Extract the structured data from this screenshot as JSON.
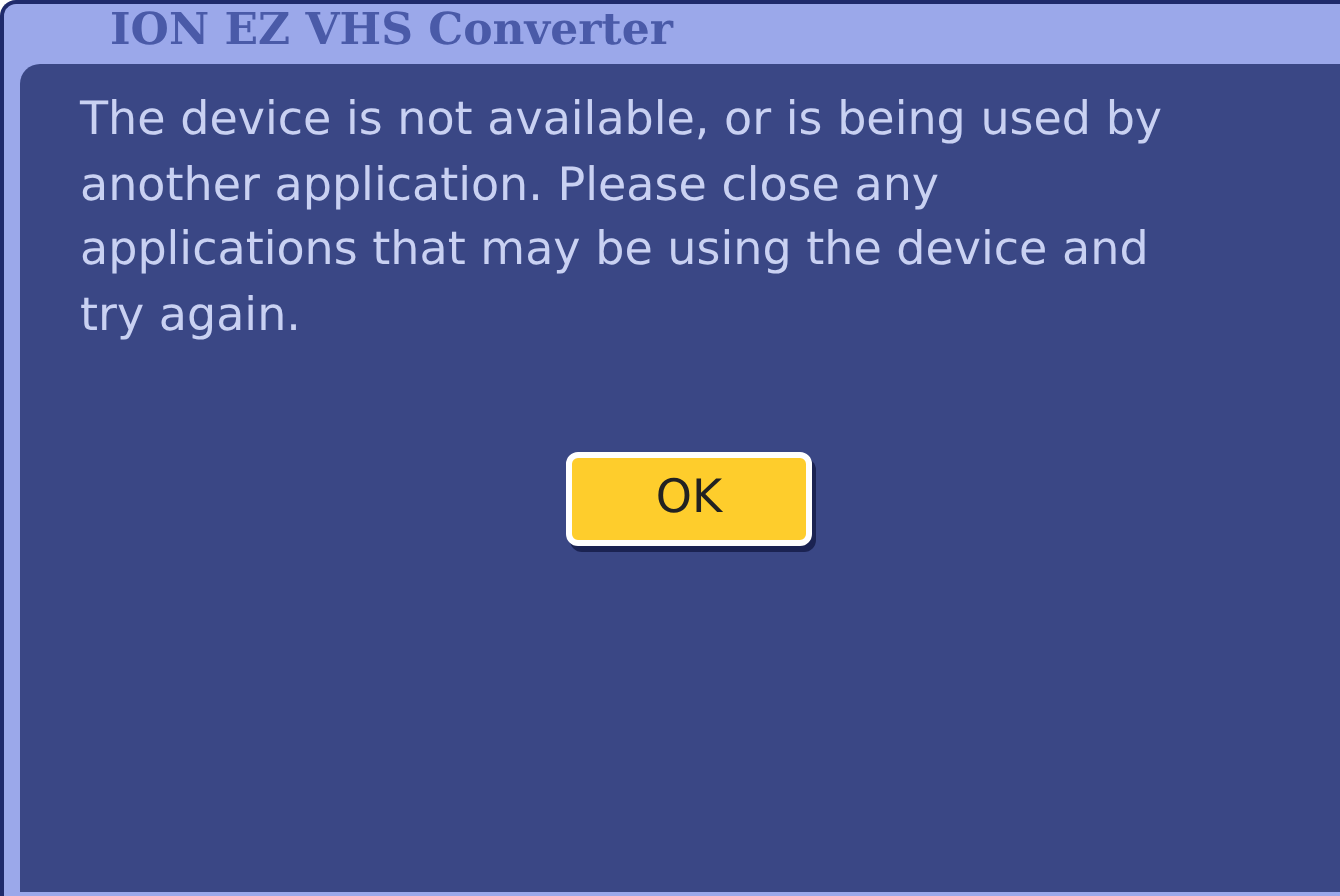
{
  "window": {
    "title": "ION EZ VHS Converter"
  },
  "message": "The device is not available, or is being used by another application. Please close any applications that may be using the device and try again.",
  "buttons": [
    "OK"
  ]
}
